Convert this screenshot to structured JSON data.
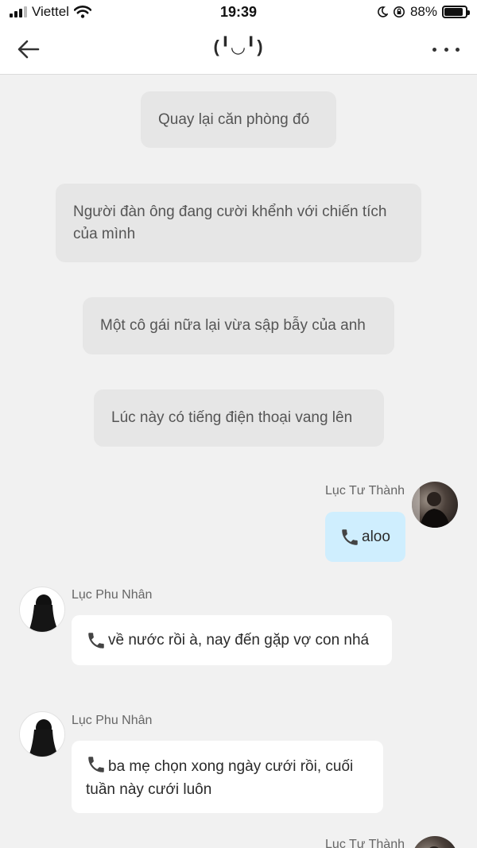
{
  "status_bar": {
    "carrier": "Viettel",
    "time": "19:39",
    "battery_percent": "88%",
    "battery_level": 0.88
  },
  "header": {
    "title": "(╹◡╹)",
    "back_icon": "arrow-left-icon",
    "menu_icon": "more-dots-icon"
  },
  "narrations": [
    "Quay lại căn phòng đó",
    "Người đàn ông đang cười khểnh với chiến tích của mình",
    "Một cô gái nữa lại vừa sập bẫy của anh",
    "Lúc này có tiếng điện thoại vang lên"
  ],
  "messages": [
    {
      "sender": "Lục Tư Thành",
      "text": "aloo",
      "side": "right"
    },
    {
      "sender": "Lục Phu Nhân",
      "text": "về nước rồi à, nay đến gặp vợ con nhá",
      "side": "left"
    },
    {
      "sender": "Lục Phu Nhân",
      "text": "ba mẹ chọn xong ngày cưới rồi, cuối tuần này cưới luôn",
      "side": "left"
    },
    {
      "sender": "Lục Tư Thành",
      "text": "",
      "side": "right"
    }
  ],
  "colors": {
    "background": "#f1f1f1",
    "narration_bubble": "#e6e6e6",
    "own_bubble": "#cfeefe",
    "other_bubble": "#ffffff"
  }
}
